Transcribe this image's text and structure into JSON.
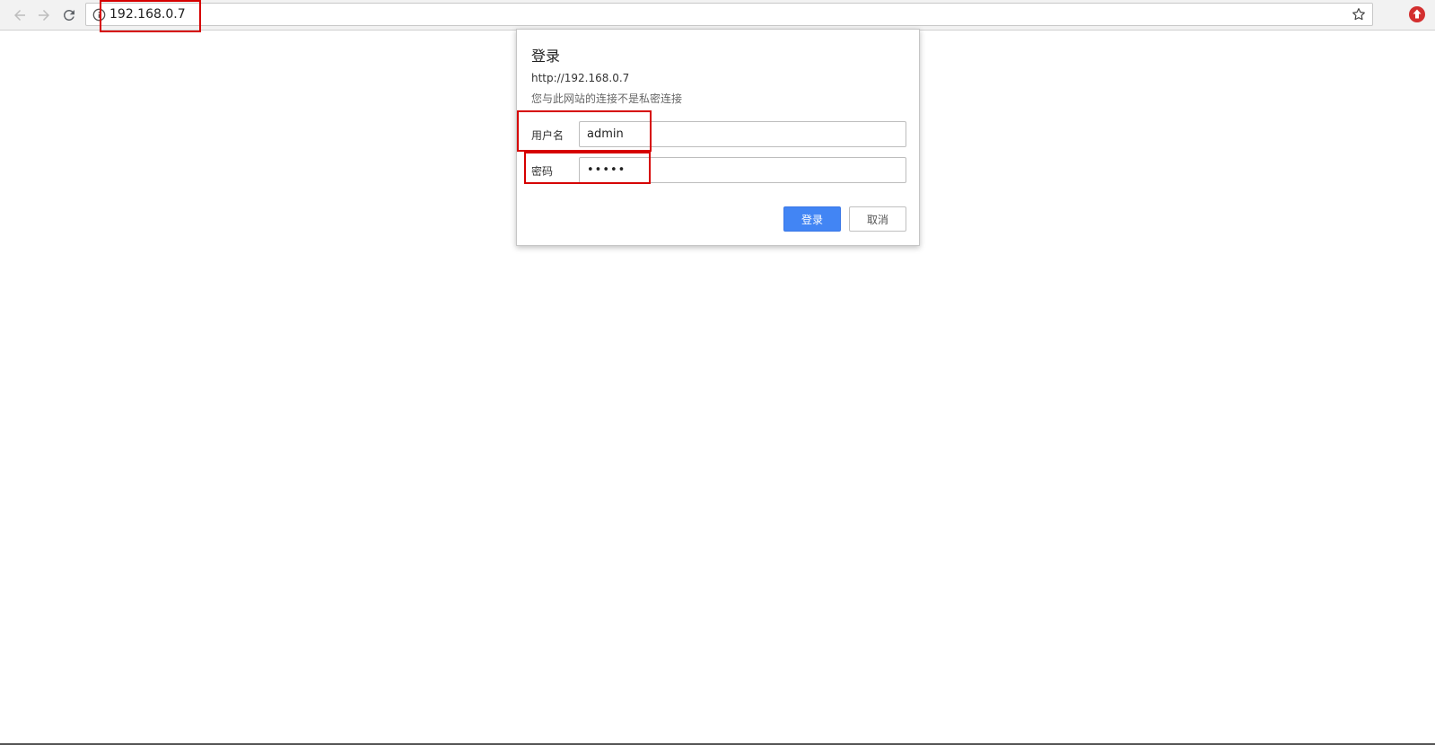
{
  "browser": {
    "url": "192.168.0.7",
    "icons": {
      "back": "back-arrow-icon",
      "forward": "forward-arrow-icon",
      "reload": "reload-icon",
      "info": "info-icon",
      "bookmark": "star-icon",
      "extension": "extension-icon"
    }
  },
  "dialog": {
    "title": "登录",
    "site_url": "http://192.168.0.7",
    "privacy_note": "您与此网站的连接不是私密连接",
    "username_label": "用户名",
    "username_value": "admin",
    "password_label": "密码",
    "password_value": "•••••",
    "login_button": "登录",
    "cancel_button": "取消"
  },
  "colors": {
    "annotation": "#d60000",
    "primary_button": "#4285f4",
    "extension": "#d32f2f"
  }
}
